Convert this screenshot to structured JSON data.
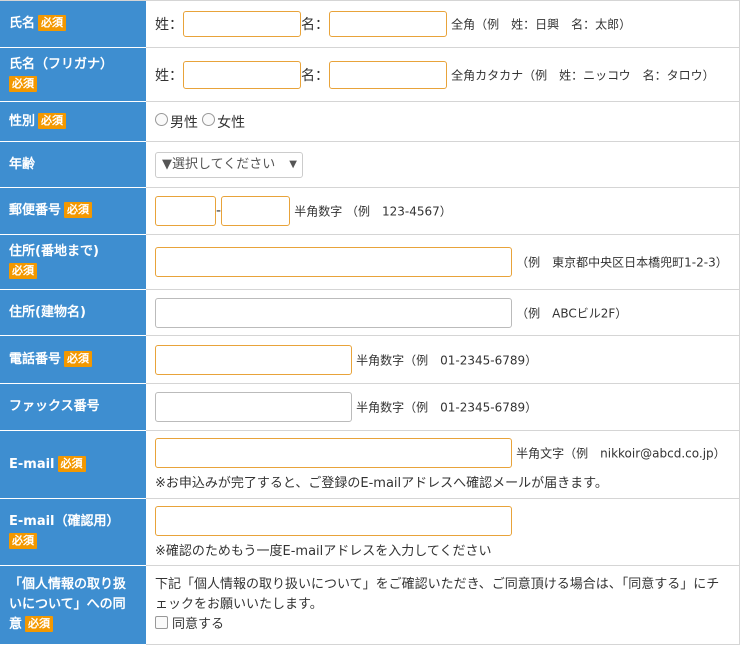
{
  "required": "必須",
  "rows": {
    "name": {
      "label": "氏名",
      "sei": "姓：",
      "mei": "名：",
      "hint": "全角（例　姓：日興　名：太郎）"
    },
    "kana": {
      "label": "氏名（フリガナ）",
      "sei": "姓：",
      "mei": "名：",
      "hint": "全角カタカナ（例　姓：ニッコウ　名：タロウ）"
    },
    "gender": {
      "label": "性別",
      "male": "男性",
      "female": "女性"
    },
    "age": {
      "label": "年齢",
      "select": "▼選択してください",
      "arrow": "▼"
    },
    "zip": {
      "label": "郵便番号",
      "dash": "-",
      "hint": "半角数字 （例　123-4567）"
    },
    "addr1": {
      "label": "住所(番地まで)",
      "hint": "（例　東京都中央区日本橋兜町1-2-3）"
    },
    "addr2": {
      "label": "住所(建物名)",
      "hint": "（例　ABCビル2F）"
    },
    "tel": {
      "label": "電話番号",
      "hint": "半角数字（例　01-2345-6789）"
    },
    "fax": {
      "label": "ファックス番号",
      "hint": "半角数字（例　01-2345-6789）"
    },
    "email": {
      "label": "E-mail",
      "hint": "半角文字（例　nikkoir@abcd.co.jp）",
      "note": "※お申込みが完了すると、ご登録のE-mailアドレスへ確認メールが届きます。"
    },
    "email2": {
      "label": "E-mail（確認用）",
      "note": "※確認のためもう一度E-mailアドレスを入力してください"
    },
    "privacy": {
      "label_line1": "「個人情報の取り扱",
      "label_line2": "いについて」への同",
      "label_line3": "意",
      "text": "下記「個人情報の取り扱いについて」をご確認いただき、ご同意頂ける場合は、「同意する」にチェックをお願いいたします。",
      "agree": "同意する"
    }
  },
  "colors": {
    "label_bg": "#3e8ed0",
    "required_bg": "#f39800",
    "input_border": "#e8a33a"
  }
}
